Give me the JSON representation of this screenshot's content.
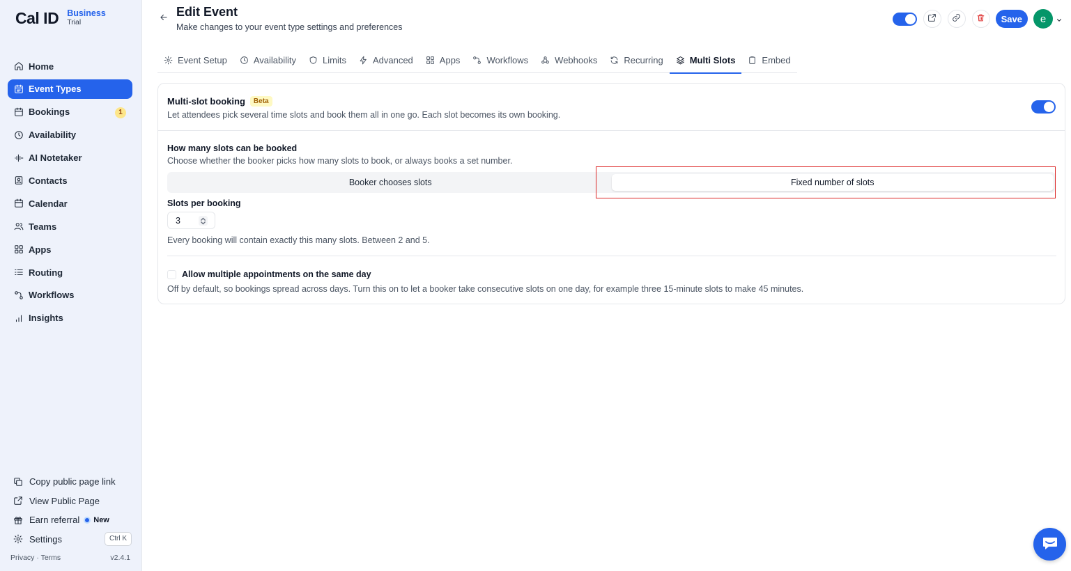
{
  "brand": {
    "logo": "Cal ID",
    "plan": "Business",
    "plan_status": "Trial"
  },
  "sidebar": {
    "items": [
      {
        "label": "Home",
        "icon": "home-icon"
      },
      {
        "label": "Event Types",
        "icon": "event-types-icon",
        "active": true
      },
      {
        "label": "Bookings",
        "icon": "calendar-icon",
        "badge": "1"
      },
      {
        "label": "Availability",
        "icon": "clock-icon"
      },
      {
        "label": "AI Notetaker",
        "icon": "waveform-icon"
      },
      {
        "label": "Contacts",
        "icon": "contacts-icon"
      },
      {
        "label": "Calendar",
        "icon": "calendar-icon"
      },
      {
        "label": "Teams",
        "icon": "users-icon"
      },
      {
        "label": "Apps",
        "icon": "apps-grid-icon"
      },
      {
        "label": "Routing",
        "icon": "routing-icon"
      },
      {
        "label": "Workflows",
        "icon": "workflow-icon"
      },
      {
        "label": "Insights",
        "icon": "bar-chart-icon"
      }
    ],
    "bottom": {
      "copy_link": "Copy public page link",
      "view_public": "View Public Page",
      "earn_referral": "Earn referral",
      "new_label": "New",
      "settings": "Settings",
      "shortcut": "Ctrl K"
    },
    "legal": "Privacy · Terms",
    "version": "v2.4.1"
  },
  "header": {
    "title": "Edit Event",
    "subtitle": "Make changes to your event type settings and preferences",
    "save_label": "Save",
    "avatar_initial": "e"
  },
  "tabs": [
    {
      "label": "Event Setup",
      "icon": "gear-icon"
    },
    {
      "label": "Availability",
      "icon": "clock-icon"
    },
    {
      "label": "Limits",
      "icon": "shield-icon"
    },
    {
      "label": "Advanced",
      "icon": "bolt-icon"
    },
    {
      "label": "Apps",
      "icon": "apps-grid-icon"
    },
    {
      "label": "Workflows",
      "icon": "workflow-icon"
    },
    {
      "label": "Webhooks",
      "icon": "webhook-icon"
    },
    {
      "label": "Recurring",
      "icon": "repeat-icon"
    },
    {
      "label": "Multi Slots",
      "icon": "layers-icon",
      "active": true
    },
    {
      "label": "Embed",
      "icon": "clipboard-icon"
    }
  ],
  "multislot": {
    "title": "Multi-slot booking",
    "beta": "Beta",
    "description": "Let attendees pick several time slots and book them all in one go. Each slot becomes its own booking.",
    "enabled": true,
    "count_label": "How many slots can be booked",
    "count_desc": "Choose whether the booker picks how many slots to book, or always books a set number.",
    "option_booker": "Booker chooses slots",
    "option_fixed": "Fixed number of slots",
    "selected_option": "Fixed number of slots",
    "slots_label": "Slots per booking",
    "slots_value": "3",
    "slots_help": "Every booking will contain exactly this many slots. Between 2 and 5.",
    "same_day_label": "Allow multiple appointments on the same day",
    "same_day_checked": false,
    "same_day_desc": "Off by default, so bookings spread across days. Turn this on to let a booker take consecutive slots on one day, for example three 15-minute slots to make 45 minutes."
  },
  "colors": {
    "accent": "#2563eb",
    "danger": "#dc2626",
    "avatar": "#059669",
    "beta_bg": "#fef9c3",
    "badge_bg": "#fde68a"
  }
}
